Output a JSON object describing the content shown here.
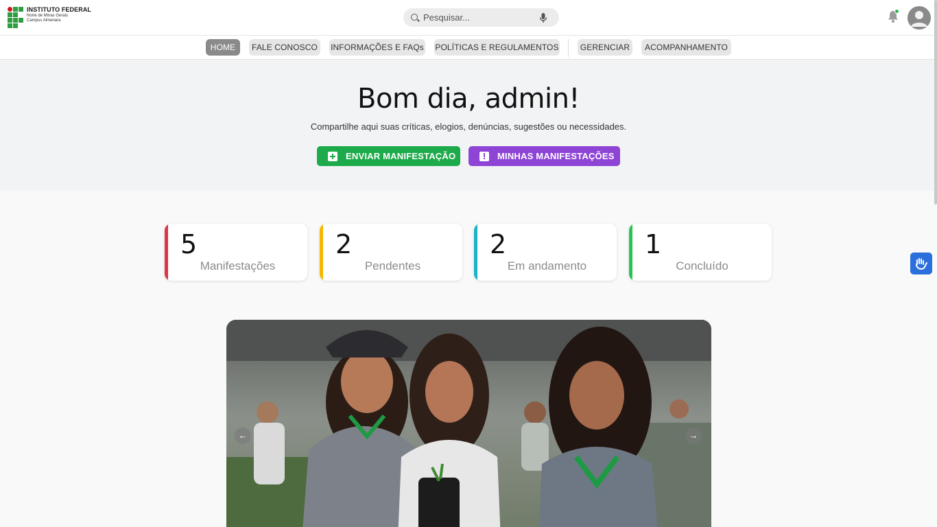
{
  "header": {
    "logo_title": "INSTITUTO FEDERAL",
    "logo_sub1": "Norte de Minas Gerais",
    "logo_sub2": "Campus Almenara",
    "search_placeholder": "Pesquisar..."
  },
  "nav": {
    "items": [
      {
        "label": "HOME",
        "active": true
      },
      {
        "label": "FALE CONOSCO",
        "active": false
      },
      {
        "label": "INFORMAÇÕES E FAQs",
        "active": false
      },
      {
        "label": "POLÍTICAS E REGULAMENTOS",
        "active": false
      },
      {
        "label": "GERENCIAR",
        "active": false
      },
      {
        "label": "ACOMPANHAMENTO",
        "active": false
      }
    ]
  },
  "hero": {
    "greeting": "Bom dia, admin!",
    "subtitle": "Compartilhe aqui suas críticas, elogios, denúncias, sugestões ou necessidades.",
    "send_button": "ENVIAR MANIFESTAÇÃO",
    "my_button": "MINHAS MANIFESTAÇÕES"
  },
  "stats": [
    {
      "value": "5",
      "label": "Manifestações",
      "color": "#dc3545"
    },
    {
      "value": "2",
      "label": "Pendentes",
      "color": "#f5b800"
    },
    {
      "value": "2",
      "label": "Em andamento",
      "color": "#17b3c7"
    },
    {
      "value": "1",
      "label": "Concluído",
      "color": "#28c44f"
    }
  ],
  "colors": {
    "green_button": "#1daa4a",
    "purple_button": "#8e45d6",
    "brand_green": "#2f9e41",
    "brand_red": "#cd191e"
  },
  "carousel": {
    "prev_icon": "arrow-left-icon",
    "next_icon": "arrow-right-icon"
  }
}
